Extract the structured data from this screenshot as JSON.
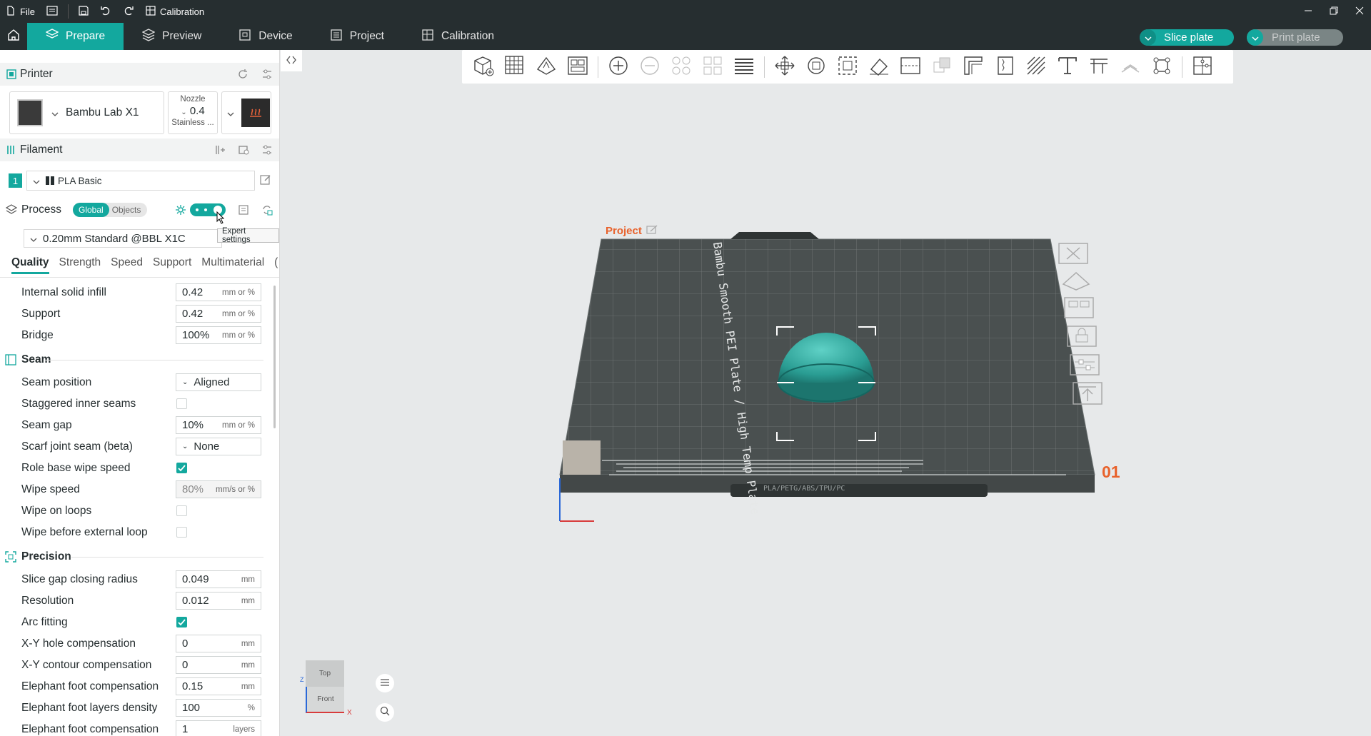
{
  "titlebar": {
    "file_label": "File",
    "calibration_label": "Calibration"
  },
  "tabs": [
    {
      "label": "Prepare"
    },
    {
      "label": "Preview"
    },
    {
      "label": "Device"
    },
    {
      "label": "Project"
    },
    {
      "label": "Calibration"
    }
  ],
  "actions": {
    "slice_label": "Slice plate",
    "print_label": "Print plate"
  },
  "printer": {
    "section_label": "Printer",
    "name": "Bambu Lab X1",
    "nozzle_title": "Nozzle",
    "nozzle_value": "0.4",
    "nozzle_material": "Stainless ..."
  },
  "filament": {
    "section_label": "Filament",
    "slot_number": "1",
    "name": "PLA Basic"
  },
  "process": {
    "section_label": "Process",
    "toggle_global": "Global",
    "toggle_objects": "Objects",
    "tooltip": "Expert settings",
    "preset": "0.20mm Standard @BBL X1C",
    "subtabs": [
      "Quality",
      "Strength",
      "Speed",
      "Support",
      "Multimaterial",
      "("
    ]
  },
  "settings": {
    "line_width_rows": [
      {
        "label": "Internal solid infill",
        "value": "0.42",
        "unit": "mm or %"
      },
      {
        "label": "Support",
        "value": "0.42",
        "unit": "mm or %"
      },
      {
        "label": "Bridge",
        "value": "100%",
        "unit": "mm or %"
      }
    ],
    "seam_title": "Seam",
    "seam_position_label": "Seam position",
    "seam_position_value": "Aligned",
    "staggered_label": "Staggered inner seams",
    "seam_gap_label": "Seam gap",
    "seam_gap_value": "10%",
    "seam_gap_unit": "mm or %",
    "scarf_label": "Scarf joint seam (beta)",
    "scarf_value": "None",
    "role_wipe_label": "Role base wipe speed",
    "wipe_speed_label": "Wipe speed",
    "wipe_speed_value": "80%",
    "wipe_speed_unit": "mm/s or %",
    "wipe_loops_label": "Wipe on loops",
    "wipe_ext_label": "Wipe before external loop",
    "precision_title": "Precision",
    "precision_rows": [
      {
        "label": "Slice gap closing radius",
        "value": "0.049",
        "unit": "mm"
      },
      {
        "label": "Resolution",
        "value": "0.012",
        "unit": "mm"
      }
    ],
    "arc_label": "Arc fitting",
    "precision_rows2": [
      {
        "label": "X-Y hole compensation",
        "value": "0",
        "unit": "mm"
      },
      {
        "label": "X-Y contour compensation",
        "value": "0",
        "unit": "mm"
      },
      {
        "label": "Elephant foot compensation",
        "value": "0.15",
        "unit": "mm"
      },
      {
        "label": "Elephant foot layers density",
        "value": "100",
        "unit": "%"
      },
      {
        "label": "Elephant foot compensation",
        "value": "1",
        "unit": "layers"
      }
    ]
  },
  "viewport": {
    "project_label": "Project",
    "plate_text": "Bambu Smooth PEI Plate / High Temp Plate",
    "plate_number": "01",
    "plate_footer": "PLA/PETG/ABS/TPU/PC",
    "view_top": "Top",
    "view_front": "Front",
    "axis_z": "Z",
    "axis_x": "X"
  },
  "colors": {
    "accent": "#13a89e",
    "titlebar": "#262e30",
    "plate_number": "#e8622c"
  }
}
